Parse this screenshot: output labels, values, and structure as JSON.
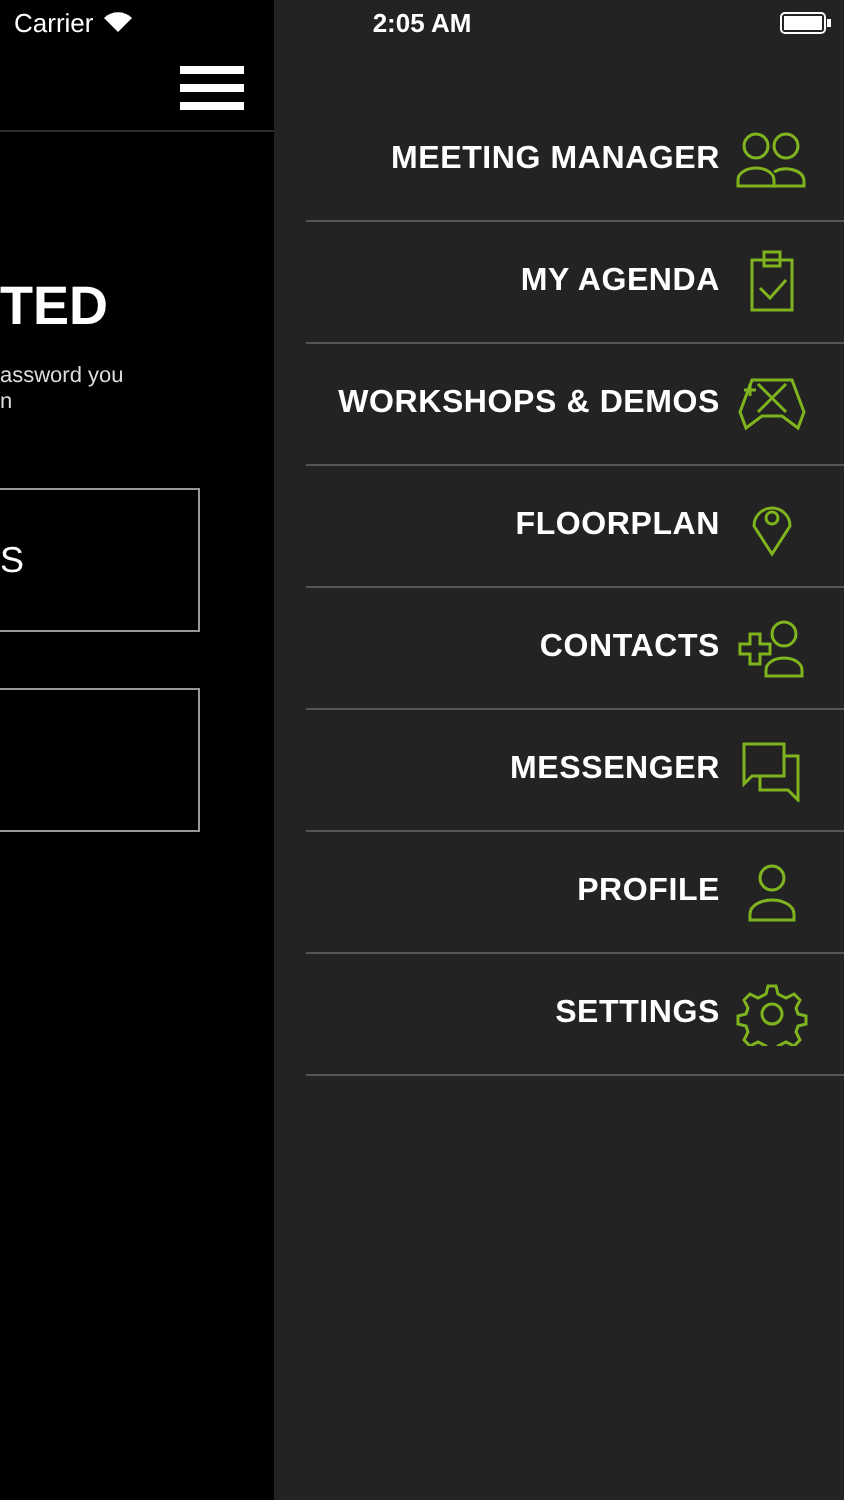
{
  "status_bar": {
    "carrier": "Carrier",
    "time": "2:05 AM"
  },
  "background_page": {
    "heading": "TED",
    "text_lines": [
      "assword you",
      "n"
    ],
    "buttons": [
      {
        "kind": "text",
        "label": "S"
      },
      {
        "kind": "empty"
      }
    ]
  },
  "menu": {
    "items": [
      {
        "label": "MEETING MANAGER"
      },
      {
        "label": "MY AGENDA"
      },
      {
        "label": "WORKSHOPS & DEMOS"
      },
      {
        "label": "FLOORPLAN"
      },
      {
        "label": "CONTACTS"
      },
      {
        "label": "MESSENGER"
      },
      {
        "label": "PROFILE"
      },
      {
        "label": "SETTINGS"
      }
    ]
  }
}
